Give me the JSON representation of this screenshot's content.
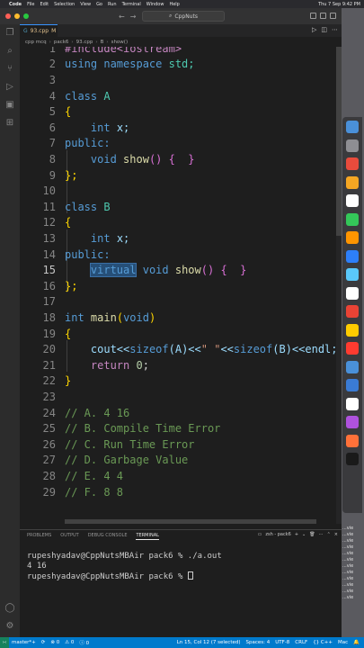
{
  "menubar": {
    "app_name": "Code",
    "items": [
      "File",
      "Edit",
      "Selection",
      "View",
      "Go",
      "Run",
      "Terminal",
      "Window",
      "Help"
    ],
    "clock": "Thu 7 Sep 9:42 PM"
  },
  "titlebar": {
    "search_text": "CppNuts",
    "colors": {
      "close": "#ff5f57",
      "minimize": "#febc2e",
      "maximize": "#28c840"
    }
  },
  "tab": {
    "filename": "93.cpp",
    "modified": "M"
  },
  "breadcrumb": {
    "parts": [
      "cpp mcq",
      "pack6",
      "93.cpp",
      "B",
      "show()"
    ]
  },
  "editor": {
    "cursor_line": 15,
    "line_numbers": [
      "1",
      "2",
      "3",
      "4",
      "5",
      "6",
      "7",
      "8",
      "9",
      "10",
      "11",
      "12",
      "13",
      "14",
      "15",
      "16",
      "17",
      "18",
      "19",
      "20",
      "21",
      "22",
      "23",
      "24",
      "25",
      "26",
      "27",
      "28",
      "29"
    ],
    "lines": {
      "l1": "#include<iostream>",
      "l2_a": "using namespace",
      "l2_b": "std;",
      "l4_kw": "class",
      "l4_name": "A",
      "l5": "{",
      "l6_ty": "int",
      "l6_rest": "x;",
      "l7": "public:",
      "l8_kw": "void",
      "l8_fn": "show",
      "l8_rest": "() {  }",
      "l9": "};",
      "l11_kw": "class",
      "l11_name": "B",
      "l12": "{",
      "l13_ty": "int",
      "l13_rest": "x;",
      "l14": "public:",
      "l15_sel": "virtual",
      "l15_kw": "void",
      "l15_fn": "show",
      "l15_rest": "() {  }",
      "l16": "};",
      "l18_ty": "int",
      "l18_fn": "main",
      "l18_arg": "void",
      "l19": "{",
      "l20_a": "cout<<",
      "l20_fn1": "sizeof",
      "l20_b": "(A)<<",
      "l20_str": "\" \"",
      "l20_c": "<<",
      "l20_fn2": "sizeof",
      "l20_d": "(B)<<endl;",
      "l21_kw": "return",
      "l21_num": "0",
      "l21_rest": ";",
      "l22": "}",
      "l24": "// A. 4 16",
      "l25": "// B. Compile Time Error",
      "l26": "// C. Run Time Error",
      "l27": "// D. Garbage Value",
      "l28": "// E. 4 4",
      "l29": "// F. 8 8"
    }
  },
  "panel": {
    "tabs": [
      "PROBLEMS",
      "OUTPUT",
      "DEBUG CONSOLE",
      "TERMINAL"
    ],
    "active_tab": "TERMINAL",
    "shell_label": "zsh - pack6",
    "terminal_lines": [
      "rupeshyadav@CppNutsMBAir pack6 % ./a.out",
      "4 16",
      "rupeshyadav@CppNutsMBAir pack6 % "
    ]
  },
  "statusbar": {
    "branch": "master*+",
    "sync": "⟳",
    "errors": "⊗ 0",
    "warnings": "⚠ 0",
    "info": "ⓘ 0",
    "position": "Ln 15, Col 12 (7 selected)",
    "spaces": "Spaces: 4",
    "encoding": "UTF-8",
    "eol": "CRLF",
    "language": "{} C++",
    "platform": "Mac"
  },
  "desktop_files": [
    "...vie",
    "...vie",
    "...vie",
    "...vie",
    "...vie",
    "...vie",
    "...vie",
    "...vie",
    "...vie",
    "...vie",
    "...vie",
    "...vie"
  ],
  "dock_colors": [
    "#4a90d9",
    "#8e8e93",
    "#e84b3c",
    "#f5a623",
    "#ffffff",
    "#34c759",
    "#ff9500",
    "#2d7ff9",
    "#5ac8fa",
    "#ffffff",
    "#ea4335",
    "#ffcc00",
    "#ff3b30",
    "#4a90d9",
    "#3a7bd5",
    "#ffffff",
    "#af52de",
    "#ff7139",
    "#1a1a1a"
  ]
}
